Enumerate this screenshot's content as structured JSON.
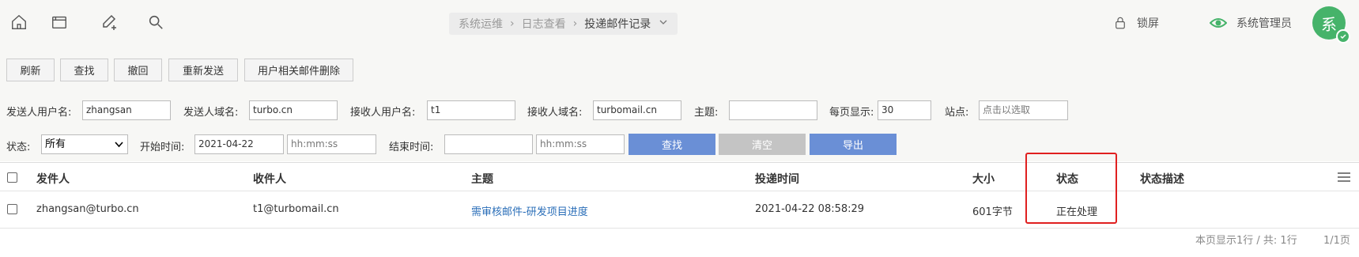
{
  "topbar": {
    "icons": [
      "home-icon",
      "browser-window-icon",
      "compose-icon",
      "search-icon"
    ],
    "breadcrumb": [
      "系统运维",
      "日志查看",
      "投递邮件记录"
    ],
    "lock_label": "锁屏",
    "admin_label": "系统管理员",
    "avatar_text": "系"
  },
  "toolbar": {
    "refresh": "刷新",
    "search": "查找",
    "recall": "撤回",
    "resend": "重新发送",
    "delete_user_mail": "用户相关邮件删除"
  },
  "filters": {
    "sender_user_label": "发送人用户名:",
    "sender_user_value": "zhangsan",
    "sender_domain_label": "发送人域名:",
    "sender_domain_value": "turbo.cn",
    "recipient_user_label": "接收人用户名:",
    "recipient_user_value": "t1",
    "recipient_domain_label": "接收人域名:",
    "recipient_domain_value": "turbomail.cn",
    "subject_label": "主题:",
    "subject_value": "",
    "per_page_label": "每页显示:",
    "per_page_value": "30",
    "site_label": "站点:",
    "site_placeholder": "点击以选取",
    "status_label": "状态:",
    "status_value": "所有",
    "start_time_label": "开始时间:",
    "start_date_value": "2021-04-22",
    "start_time_placeholder": "hh:mm:ss",
    "end_time_label": "结束时间:",
    "end_date_value": "",
    "end_time_placeholder": "hh:mm:ss",
    "find_button": "查找",
    "clear_button": "清空",
    "export_button": "导出"
  },
  "table": {
    "columns": [
      "发件人",
      "收件人",
      "主题",
      "投递时间",
      "大小",
      "状态",
      "状态描述"
    ],
    "rows": [
      {
        "sender": "zhangsan@turbo.cn",
        "recipient": "t1@turbomail.cn",
        "subject": "需审核邮件-研发项目进度",
        "time": "2021-04-22 08:58:29",
        "size": "601字节",
        "status": "正在处理",
        "status_desc": ""
      }
    ]
  },
  "pager": {
    "summary": "本页显示1行 / 共: 1行",
    "pages": "1/1页"
  },
  "colors": {
    "accent_blue": "#6a8fd6",
    "clear_gray": "#c4c4c4",
    "avatar_green": "#46b36a",
    "highlight_red": "#e02020",
    "link_blue": "#2a6eb8"
  }
}
